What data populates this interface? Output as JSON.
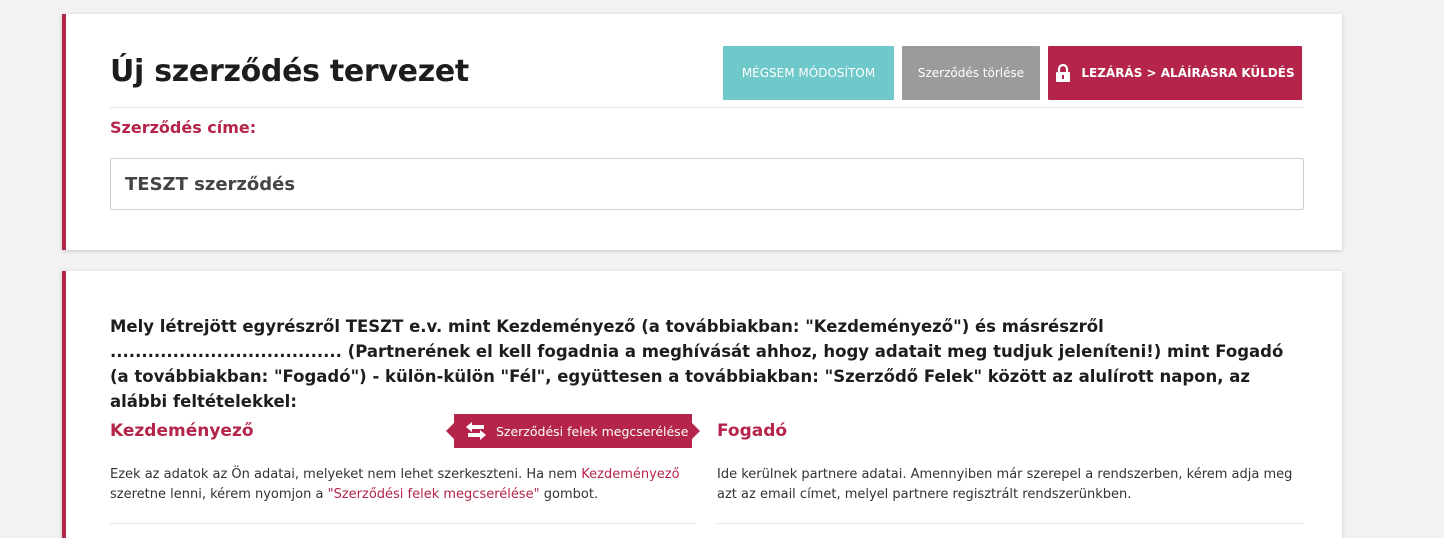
{
  "header": {
    "title": "Új szerződés tervezet",
    "buttons": {
      "cancel": "MÉGSEM MÓDOSÍTOM",
      "delete": "Szerződés törlése",
      "lock_send": "LEZÁRÁS > ALÁÍRÁSRA KÜLDÉS"
    },
    "lock_icon": "lock-icon"
  },
  "contract_title": {
    "label": "Szerződés címe:",
    "value": "TESZT szerződés"
  },
  "body": {
    "intro": "Mely létrejött egyrészről TESZT e.v. mint Kezdeményező (a továbbiakban: \"Kezdeményező\") és másrészről ..................................... (Partnerének el kell fogadnia a meghívását ahhoz, hogy adatait meg tudjuk jeleníteni!) mint Fogadó (a továbbiakban: \"Fogadó\") - külön-külön \"Fél\", együttesen a továbbiakban: \"Szerződő Felek\" között az alulírott napon, az alábbi feltételekkel:",
    "swap_button": "Szerződési felek megcserélése",
    "swap_icon": "swap-arrows-icon",
    "left": {
      "title": "Kezdeményező",
      "desc_part1": "Ezek az adatok az Ön adatai, melyeket nem lehet szerkeszteni. Ha nem ",
      "desc_link1": "Kezdeményező",
      "desc_part2": " szeretne lenni, kérem nyomjon a ",
      "desc_link2": "\"Szerződési felek megcserélése\"",
      "desc_part3": " gombot."
    },
    "right": {
      "title": "Fogadó",
      "desc": "Ide kerülnek partnere adatai. Amennyiben már szerepel a rendszerben, kérem adja meg azt az email címet, melyel partnere regisztrált rendszerünkben."
    }
  },
  "colors": {
    "accent": "#b5254b",
    "teal": "#6fc8c9",
    "gray": "#9b9b9b"
  }
}
